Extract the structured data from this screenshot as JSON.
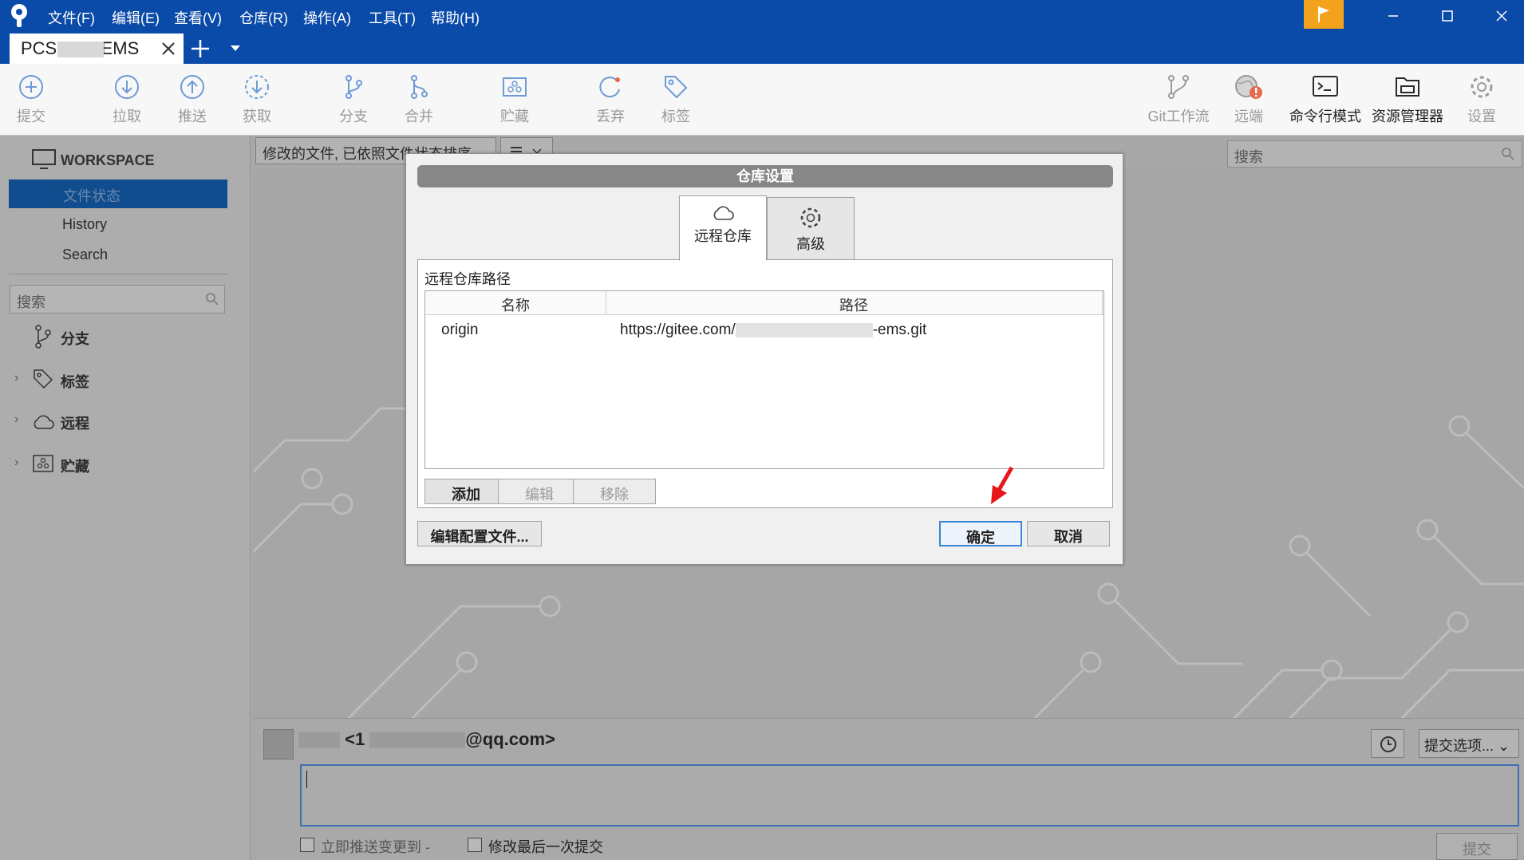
{
  "menu": {
    "items": [
      "文件(F)",
      "编辑(E)",
      "查看(V)",
      "仓库(R)",
      "操作(A)",
      "工具(T)",
      "帮助(H)"
    ]
  },
  "tab": {
    "label_start": "PCS-",
    "label_end": "EMS"
  },
  "toolbar": {
    "commit": "提交",
    "pull": "拉取",
    "push": "推送",
    "fetch": "获取",
    "branch": "分支",
    "merge": "合并",
    "stash": "贮藏",
    "discard": "丢弃",
    "tag": "标签",
    "gitflow": "Git工作流",
    "remote": "远端",
    "terminal": "命令行模式",
    "explorer": "资源管理器",
    "settings": "设置"
  },
  "sidebar": {
    "workspace": "WORKSPACE",
    "file_status": "文件状态",
    "history": "History",
    "search": "Search",
    "search_placeholder": "搜索",
    "branches": "分支",
    "tags": "标签",
    "remotes": "远程",
    "stashes": "贮藏"
  },
  "main": {
    "filter": "修改的文件, 已依照文件状态排序",
    "search_placeholder": "搜索",
    "author_prefix": "<1",
    "author_suffix": "@qq.com>",
    "commit_options": "提交选项...",
    "push_immediately": "立即推送变更到 -",
    "amend": "修改最后一次提交",
    "commit_button": "提交"
  },
  "dialog": {
    "title": "仓库设置",
    "tab_remote": "远程仓库",
    "tab_advanced": "高级",
    "panel_heading": "远程仓库路径",
    "col_name": "名称",
    "col_path": "路径",
    "rows": [
      {
        "name": "origin",
        "path_start": "https://gitee.com/",
        "path_end": "-ems.git"
      }
    ],
    "add": "添加",
    "edit": "编辑",
    "remove": "移除",
    "edit_config": "编辑配置文件...",
    "ok": "确定",
    "cancel": "取消"
  },
  "colors": {
    "titlebar": "#0a4aa8",
    "flag": "#f3a21b",
    "ok_border": "#3a86d8",
    "arrow": "#e8161b"
  }
}
